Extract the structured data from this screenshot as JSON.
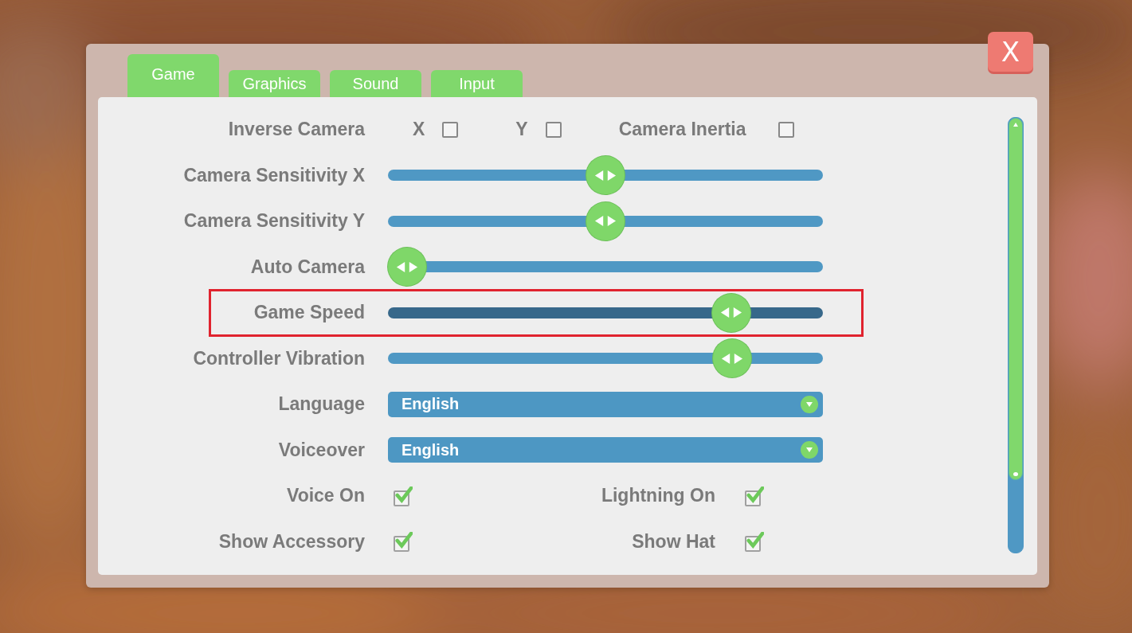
{
  "close_button": {
    "label": "X"
  },
  "tabs": [
    {
      "label": "Game",
      "selected": true
    },
    {
      "label": "Graphics",
      "selected": false
    },
    {
      "label": "Sound",
      "selected": false
    },
    {
      "label": "Input",
      "selected": false
    }
  ],
  "rows": [
    {
      "kind": "toggles",
      "label": "Inverse Camera",
      "items": [
        {
          "label": "X",
          "checked": false
        },
        {
          "label": "Y",
          "checked": false
        },
        {
          "label": "Camera Inertia",
          "checked": false
        }
      ]
    },
    {
      "kind": "slider",
      "label": "Camera Sensitivity X",
      "level": 0.5,
      "highlighted": false
    },
    {
      "kind": "slider",
      "label": "Camera Sensitivity Y",
      "level": 0.5,
      "highlighted": false
    },
    {
      "kind": "slider",
      "label": "Auto Camera",
      "level": 0,
      "highlighted": false
    },
    {
      "kind": "slider",
      "label": "Game Speed",
      "level": 0.817,
      "highlighted": true
    },
    {
      "kind": "slider",
      "label": "Controller Vibration",
      "level": 0.82,
      "highlighted": false
    },
    {
      "kind": "dropdown",
      "label": "Language",
      "value": "English"
    },
    {
      "kind": "dropdown",
      "label": "Voiceover",
      "value": "English"
    },
    {
      "kind": "pair",
      "label": "Voice On",
      "checked": true,
      "second_label": "Lightning On",
      "second_checked": true
    },
    {
      "kind": "pair",
      "label": "Show Accessory",
      "checked": true,
      "second_label": "Show Hat",
      "second_checked": true
    }
  ]
}
